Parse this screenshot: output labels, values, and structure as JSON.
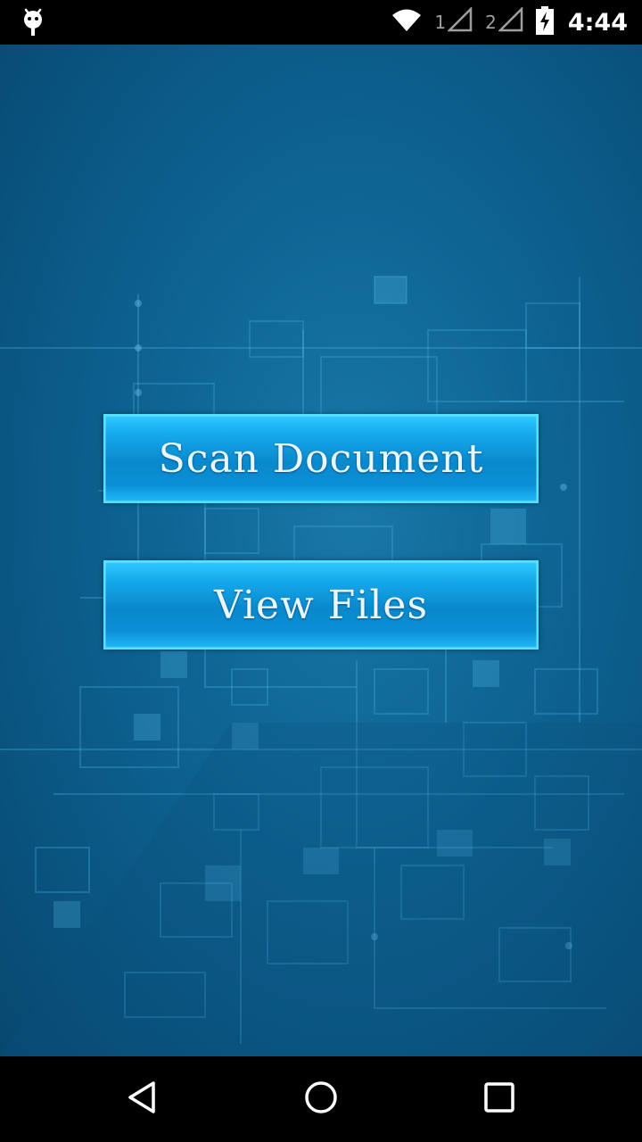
{
  "status_bar": {
    "time": "4:44",
    "sim1_label": "1",
    "sim2_label": "2",
    "icons": [
      "android-debug-icon",
      "wifi-icon",
      "signal-icon",
      "signal-icon",
      "battery-charging-icon"
    ]
  },
  "main": {
    "buttons": [
      {
        "label": "Scan Document"
      },
      {
        "label": "View Files"
      }
    ]
  },
  "nav_bar": {
    "icons": [
      "back-icon",
      "home-icon",
      "recent-apps-icon"
    ]
  },
  "colors": {
    "background": "#0f6796",
    "button_fill": "#0a88cc",
    "button_border": "#4fe3ff"
  }
}
